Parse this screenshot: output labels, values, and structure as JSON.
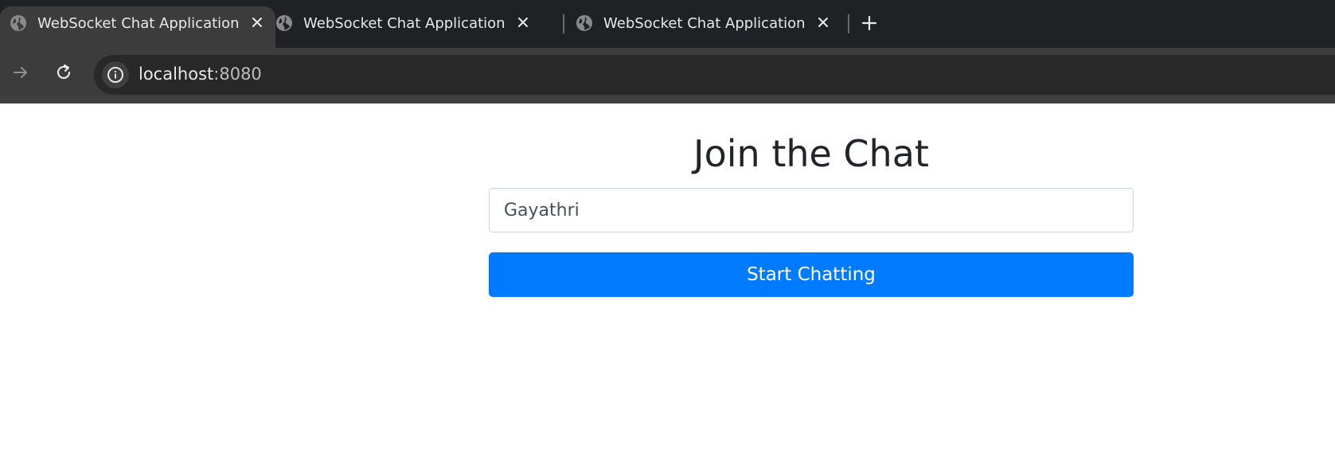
{
  "browser": {
    "tabs": [
      {
        "title": "WebSocket Chat Application",
        "active": true
      },
      {
        "title": "WebSocket Chat Application",
        "active": false
      },
      {
        "title": "WebSocket Chat Application",
        "active": false
      }
    ],
    "address": {
      "host": "localhost",
      "port": ":8080"
    }
  },
  "page": {
    "title": "Join the Chat",
    "username_value": "Gayathri",
    "start_button_label": "Start Chatting"
  },
  "colors": {
    "tab_strip": "#202124",
    "toolbar": "#3c3c3c",
    "primary_button": "#007bff",
    "title_text": "#212529"
  },
  "icons": {
    "favicon": "globe-icon",
    "tab_close": "close-icon",
    "new_tab": "plus-icon",
    "forward": "arrow-right-icon",
    "reload": "reload-icon",
    "site_info": "info-icon"
  }
}
